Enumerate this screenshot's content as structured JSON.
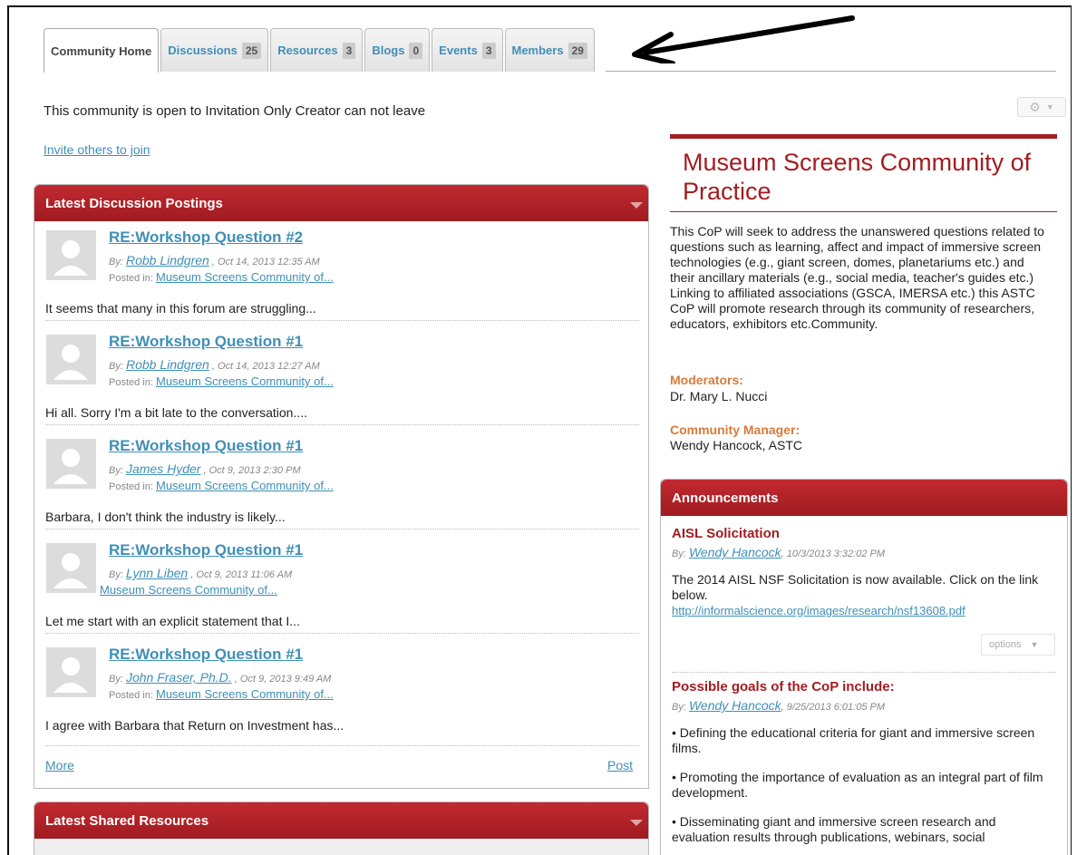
{
  "tabs": [
    {
      "label": "Community Home",
      "count": null,
      "active": true
    },
    {
      "label": "Discussions",
      "count": "25",
      "active": false
    },
    {
      "label": "Resources",
      "count": "3",
      "active": false
    },
    {
      "label": "Blogs",
      "count": "0",
      "active": false
    },
    {
      "label": "Events",
      "count": "3",
      "active": false
    },
    {
      "label": "Members",
      "count": "29",
      "active": false
    }
  ],
  "community": {
    "open_text": "This community is open to Invitation Only Creator can not leave",
    "invite_link": "Invite others to join"
  },
  "discussions": {
    "header": "Latest Discussion Postings",
    "posts": [
      {
        "title": "RE:Workshop Question #2",
        "by_label": "By:",
        "author": "Robb Lindgren",
        "date": ", Oct 14, 2013 12:35 AM",
        "posted_in_label": "Posted in:",
        "posted_in": "Museum Screens Community of...",
        "excerpt": "It seems that many in this forum are struggling..."
      },
      {
        "title": "RE:Workshop Question #1",
        "by_label": "By:",
        "author": "Robb Lindgren",
        "date": ", Oct 14, 2013 12:27 AM",
        "posted_in_label": "Posted in:",
        "posted_in": "Museum Screens Community of...",
        "excerpt": "Hi all. Sorry I'm a bit late to the conversation...."
      },
      {
        "title": "RE:Workshop Question #1",
        "by_label": "By:",
        "author": "James Hyder",
        "date": ", Oct 9, 2013 2:30 PM",
        "posted_in_label": "Posted in:",
        "posted_in": "Museum Screens Community of...",
        "excerpt": "Barbara, I don't think the industry is likely..."
      },
      {
        "title": "RE:Workshop Question #1",
        "by_label": "By:",
        "author": "Lynn Liben",
        "date": ", Oct 9, 2013 11:06 AM",
        "posted_in_label": "",
        "posted_in": "Museum Screens Community of...",
        "excerpt": "Let me start with an explicit statement that I..."
      },
      {
        "title": "RE:Workshop Question #1",
        "by_label": "By:",
        "author": "John Fraser, Ph.D.",
        "date": ", Oct 9, 2013 9:49 AM",
        "posted_in_label": "Posted in:",
        "posted_in": "Museum Screens Community of...",
        "excerpt": "I agree with Barbara that Return on Investment has..."
      }
    ],
    "more_link": "More",
    "post_link": "Post"
  },
  "resources": {
    "header": "Latest Shared Resources"
  },
  "about": {
    "title": "Museum Screens Community of Practice",
    "description": "This CoP will seek to address the unanswered questions related to questions such as learning, affect and impact of immersive screen technologies (e.g., giant screen, domes, planetariums etc.) and their ancillary materials (e.g., social media, teacher's guides etc.) Linking to affiliated associations (GSCA, IMERSA etc.) this ASTC CoP will promote research through its community of researchers, educators, exhibitors etc.Community.",
    "moderators_label": "Moderators:",
    "moderators": "Dr. Mary L. Nucci",
    "manager_label": "Community Manager:",
    "manager": "Wendy Hancock, ASTC"
  },
  "announcements": {
    "header": "Announcements",
    "items": [
      {
        "title": "AISL Solicitation",
        "by_label": "By:",
        "author": "Wendy Hancock",
        "date": ", 10/3/2013 3:32:02 PM",
        "body": "The 2014 AISL NSF Solicitation is now available. Click on the link below.",
        "link": "http://informalscience.org/images/research/nsf13608.pdf",
        "options_label": "options"
      },
      {
        "title": "Possible goals of the CoP include:",
        "by_label": "By:",
        "author": "Wendy Hancock",
        "date": ", 9/25/2013 6:01:05 PM",
        "bullets": [
          "• Defining the educational criteria for giant and immersive screen films.",
          "• Promoting the importance of evaluation as an integral part of film development.",
          "• Disseminating giant and immersive screen research and evaluation results through publications, webinars, social"
        ]
      }
    ]
  },
  "colors": {
    "accent": "#a31d21",
    "link": "#3f8fb8",
    "label_orange": "#d87b3c"
  },
  "icons": [
    "gear-icon",
    "caret-down-icon",
    "avatar-placeholder-icon",
    "arrow-annotation-icon"
  ]
}
